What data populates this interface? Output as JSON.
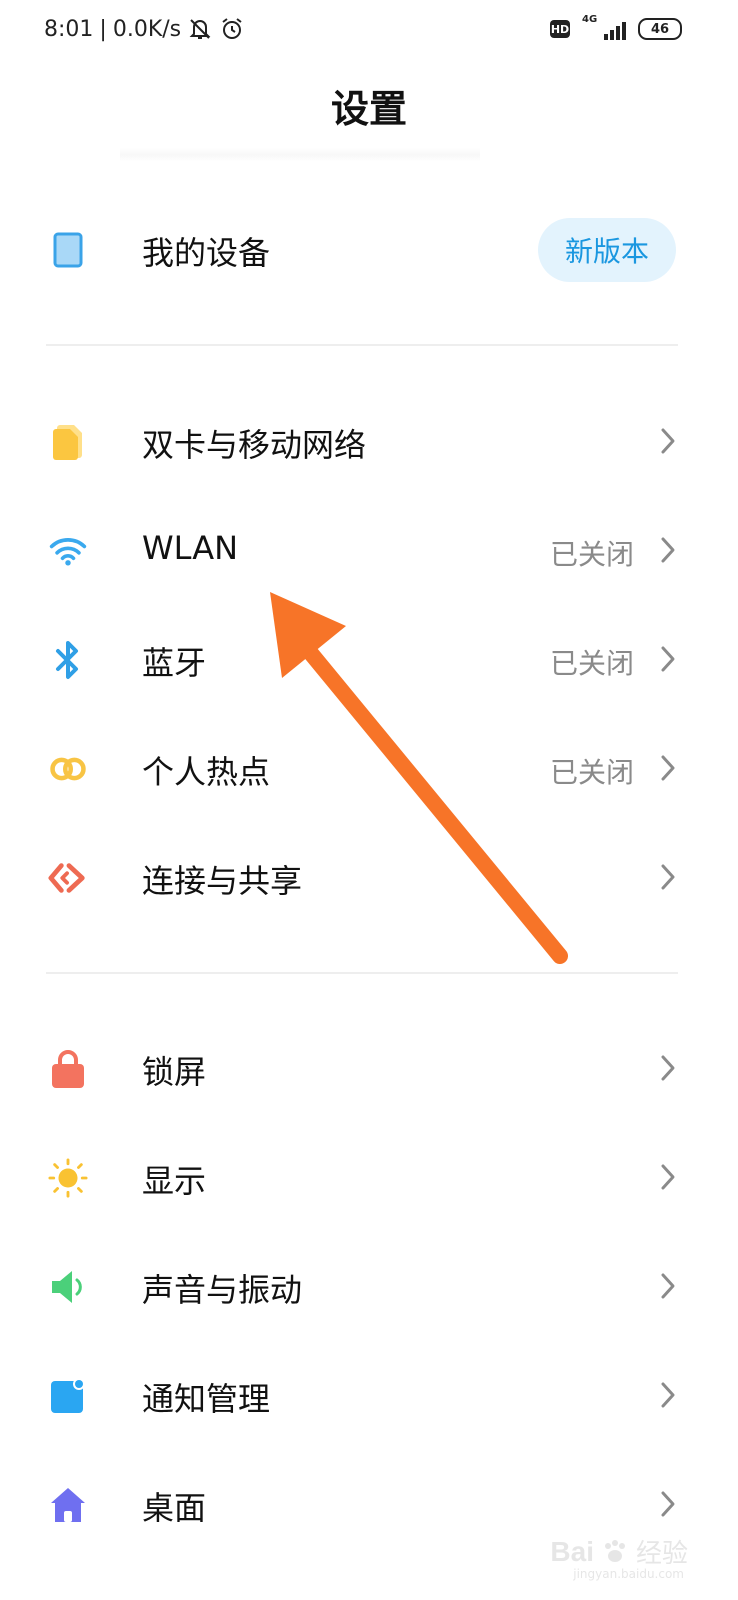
{
  "statusbar": {
    "time": "8:01",
    "separator": "|",
    "speed": "0.0K/s",
    "hd": "HD",
    "network": "4G",
    "battery": "46"
  },
  "page": {
    "title": "设置"
  },
  "my_device": {
    "label": "我的设备",
    "badge": "新版本"
  },
  "network_items": [
    {
      "label": "双卡与移动网络",
      "icon": "sim-card-icon",
      "status": ""
    },
    {
      "label": "WLAN",
      "icon": "wifi-icon",
      "status": "已关闭"
    },
    {
      "label": "蓝牙",
      "icon": "bluetooth-icon",
      "status": "已关闭"
    },
    {
      "label": "个人热点",
      "icon": "hotspot-icon",
      "status": "已关闭"
    },
    {
      "label": "连接与共享",
      "icon": "share-icon",
      "status": ""
    }
  ],
  "system_items": [
    {
      "label": "锁屏",
      "icon": "lock-icon"
    },
    {
      "label": "显示",
      "icon": "sun-icon"
    },
    {
      "label": "声音与振动",
      "icon": "speaker-icon"
    },
    {
      "label": "通知管理",
      "icon": "notification-icon"
    },
    {
      "label": "桌面",
      "icon": "home-icon"
    }
  ],
  "watermark": {
    "brand": "Bai",
    "cn": "经验",
    "url": "jingyan.baidu.com"
  },
  "colors": {
    "accent": "#1a97e0",
    "pill_bg": "#e3f3fd",
    "arrow": "#f77428",
    "status_text": "#8a8a8a"
  }
}
